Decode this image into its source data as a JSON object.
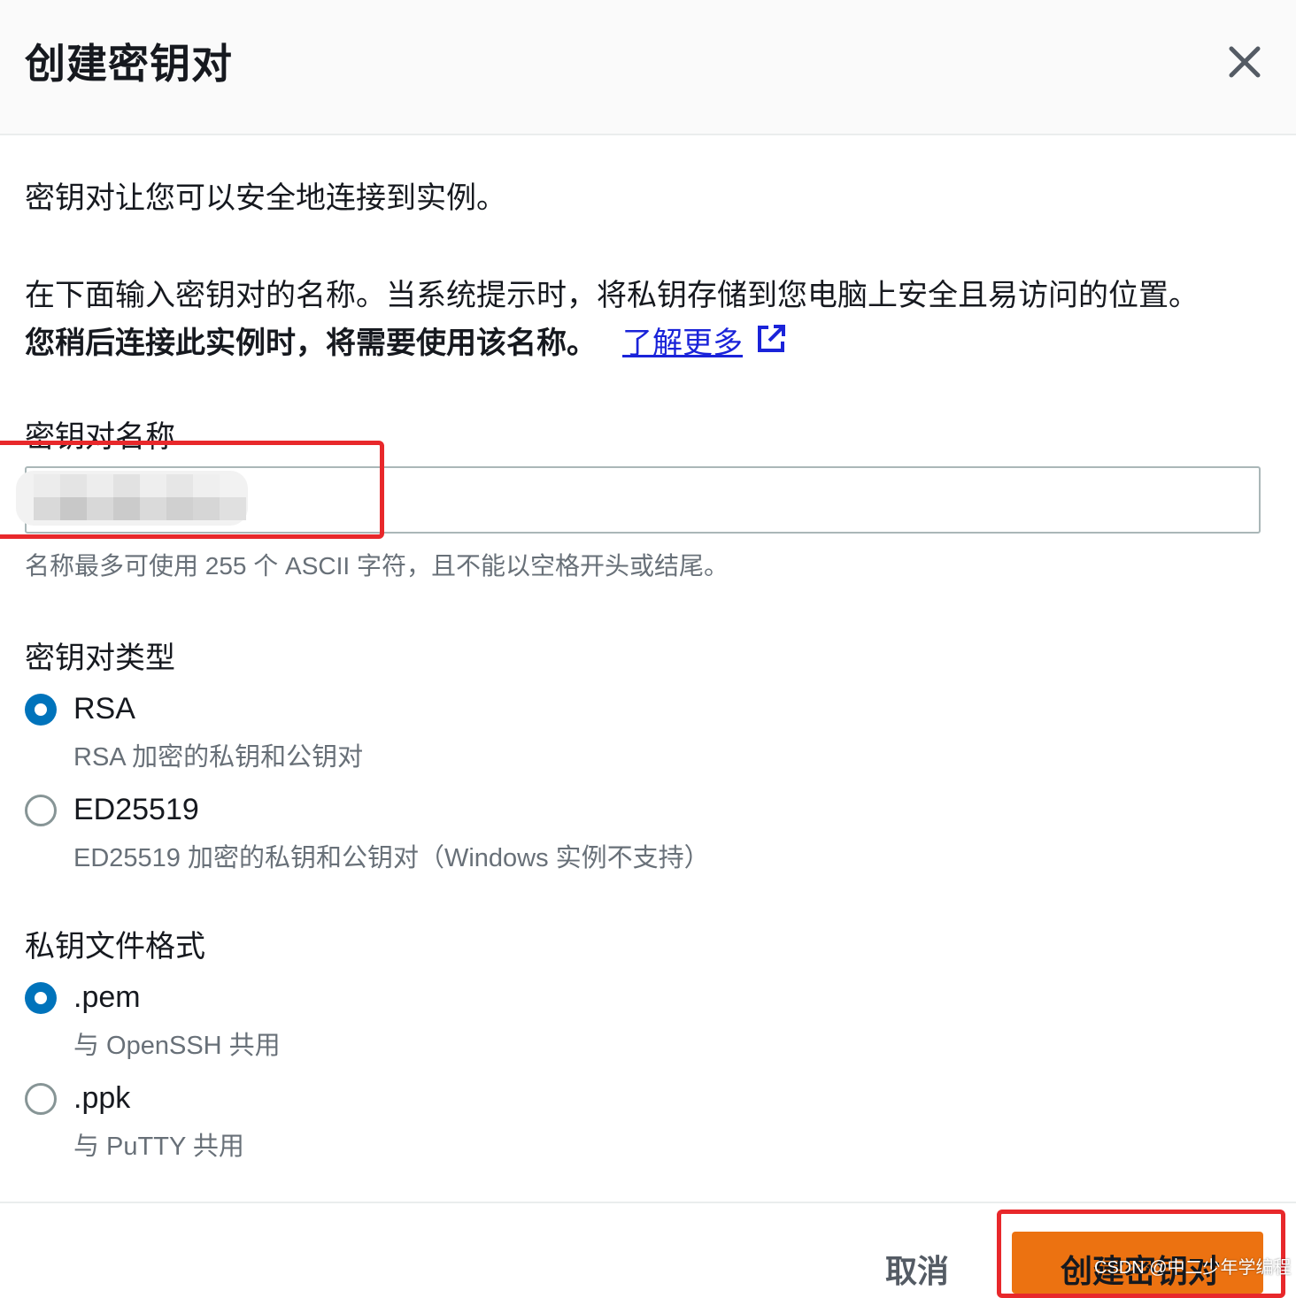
{
  "dialog": {
    "title": "创建密钥对",
    "close_icon": "close-icon"
  },
  "intro": {
    "line1": "密钥对让您可以安全地连接到实例。",
    "line2": "在下面输入密钥对的名称。当系统提示时，将私钥存储到您电脑上安全且易访问的位置。",
    "line3": "您稍后连接此实例时，将需要使用该名称。",
    "learn_more": "了解更多",
    "learn_more_icon": "external-link-icon"
  },
  "key_name": {
    "label": "密钥对名称",
    "value": "",
    "hint": "名称最多可使用 255 个 ASCII 字符，且不能以空格开头或结尾。"
  },
  "key_type": {
    "label": "密钥对类型",
    "options": [
      {
        "label": "RSA",
        "description": "RSA 加密的私钥和公钥对",
        "selected": true
      },
      {
        "label": "ED25519",
        "description": "ED25519 加密的私钥和公钥对（Windows 实例不支持）",
        "selected": false
      }
    ]
  },
  "file_format": {
    "label": "私钥文件格式",
    "options": [
      {
        "label": ".pem",
        "description": "与 OpenSSH 共用",
        "selected": true
      },
      {
        "label": ".ppk",
        "description": "与 PuTTY 共用",
        "selected": false
      }
    ]
  },
  "footer": {
    "cancel_label": "取消",
    "create_label": "创建密钥对"
  },
  "watermark": "CSDN @中二少年学编程",
  "colors": {
    "accent_blue": "#0073bb",
    "link_blue": "#1a23d9",
    "primary_orange": "#ec7211",
    "highlight_red": "#e8282b"
  }
}
